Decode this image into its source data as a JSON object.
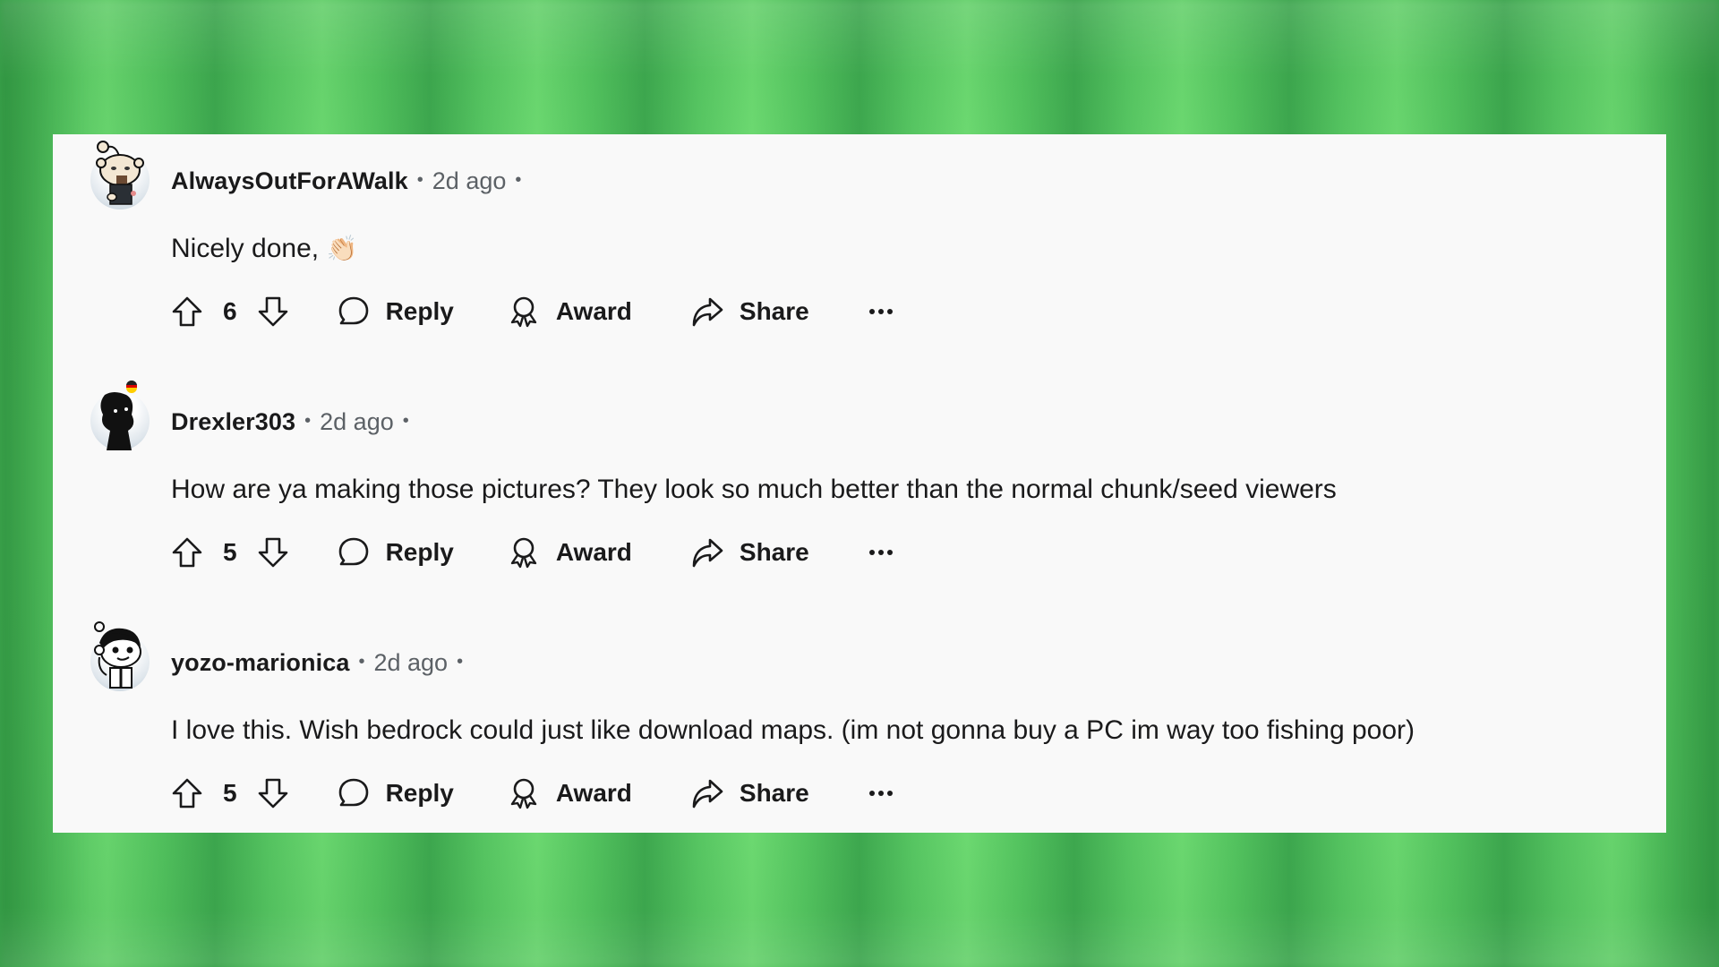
{
  "theme": {
    "card_background": "#f9f9f9",
    "text_primary": "#1a1a1b",
    "text_secondary": "#5c6166",
    "background_green_light": "#6edb72",
    "background_green_dark": "#3ea84f"
  },
  "comments": [
    {
      "username": "AlwaysOutForAWalk",
      "time": "2d ago",
      "body": "Nicely done,",
      "emoji": "👏🏻",
      "avatar_icon": "snoo-avatar-bearded",
      "score": "6",
      "actions": {
        "reply": "Reply",
        "award": "Award",
        "share": "Share",
        "more": "more-options-icon"
      }
    },
    {
      "username": "Drexler303",
      "time": "2d ago",
      "body": "How are ya making those pictures? They look so much better than the normal chunk/seed viewers",
      "emoji": "",
      "avatar_icon": "snoo-avatar-silhouette-with-german-flag",
      "score": "5",
      "actions": {
        "reply": "Reply",
        "award": "Award",
        "share": "Share",
        "more": "more-options-icon"
      }
    },
    {
      "username": "yozo-marionica",
      "time": "2d ago",
      "body": "I love this. Wish bedrock could just like download maps. (im not gonna buy a PC im way too fishing poor)",
      "emoji": "",
      "avatar_icon": "snoo-avatar-dark-hair",
      "score": "5",
      "actions": {
        "reply": "Reply",
        "award": "Award",
        "share": "Share",
        "more": "more-options-icon"
      }
    }
  ]
}
